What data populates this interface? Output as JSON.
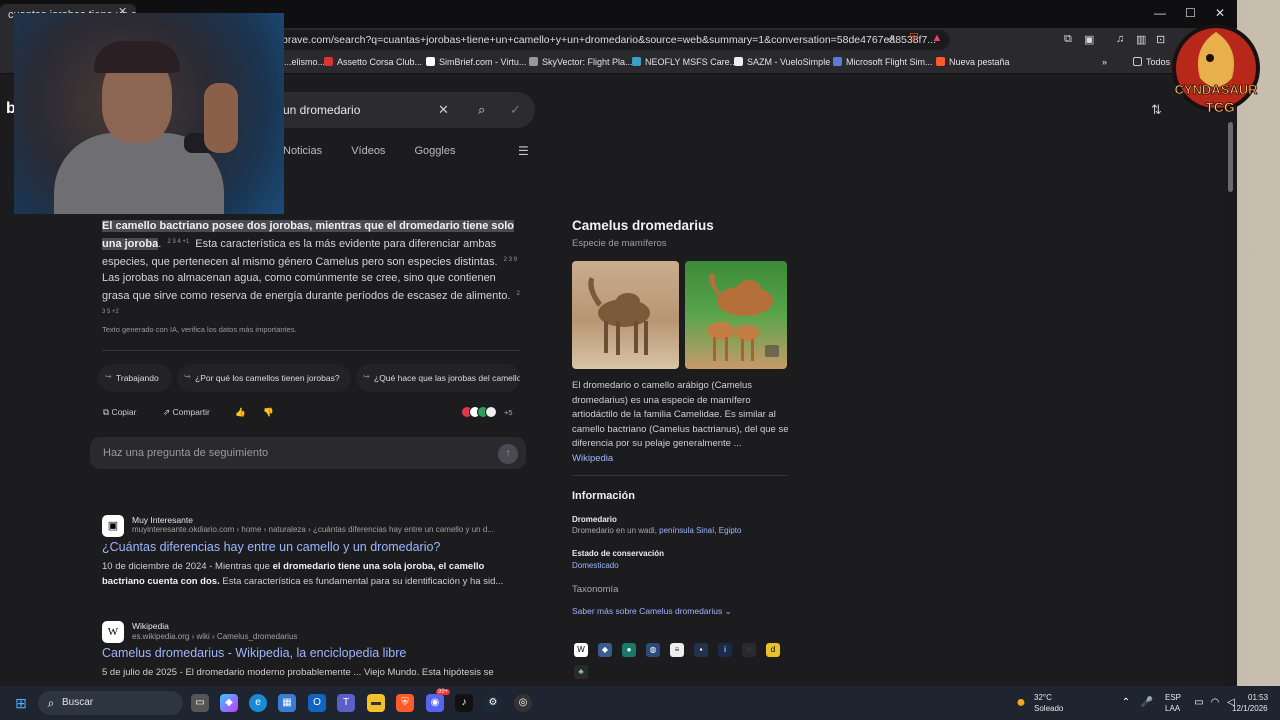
{
  "browser": {
    "tab_title": "cuantas jorobas tiene un camell",
    "url": "brave.com/search?q=cuantas+jorobas+tiene+un+camello+y+un+dromedario&source=web&summary=1&conversation=58de4767ea8538f7...",
    "shield_badge": "2",
    "bookmarks": [
      "...elismo...",
      "Assetto Corsa Club...",
      "SimBrief.com - Virtu...",
      "SkyVector: Flight Pla...",
      "NEOFLY MSFS Care...",
      "SAZM - VueloSimple",
      "Microsoft Flight Sim...",
      "Nueva pestaña",
      "Todos"
    ]
  },
  "search": {
    "query_visible": "un dromedario",
    "tabs": [
      "Noticias",
      "Vídeos",
      "Goggles"
    ]
  },
  "summary": {
    "highlight": "El camello bactriano posee dos jorobas, mientras que el dromedario tiene solo una joroba",
    "after_highlight": ".",
    "cite1": "2 3 4 +1",
    "text1": "Esta característica es la más evidente para diferenciar ambas especies, que pertenecen al mismo género Camelus pero son especies distintas.",
    "cite2": "2 3 9",
    "text2": "Las jorobas no almacenan agua, como comúnmente se cree, sino que contienen grasa que sirve como reserva de energía durante períodos de escasez de alimento.",
    "cite3": "2 3 5 +2",
    "note": "Texto generado con IA, verifica los datos más importantes.",
    "chips": [
      "Trabajando",
      "¿Por qué los camellos tienen jorobas?",
      "¿Qué hace que las jorobas del camello"
    ],
    "copy": "Copiar",
    "share": "Compartir",
    "more_sources": "+5",
    "followup_placeholder": "Haz una pregunta de seguimiento"
  },
  "results": [
    {
      "favicon": "▣",
      "site": "Muy Interesante",
      "url": "muyinteresante.okdiario.com › home › naturaleza › ¿cuántas diferencias hay entre un camello y un d...",
      "title": "¿Cuántas diferencias hay entre un camello y un dromedario?",
      "date": "10 de diciembre de 2024 - ",
      "desc_a": "Mientras que ",
      "desc_b": "el dromedario tiene una sola joroba, el camello bactriano cuenta con dos.",
      "desc_c": " Esta característica es fundamental para su identificación y ha sid..."
    },
    {
      "favicon": "W",
      "site": "Wikipedia",
      "url": "es.wikipedia.org › wiki › Camelus_dromedarius",
      "title": "Camelus dromedarius - Wikipedia, la enciclopedia libre",
      "date": "5 de julio de 2025 - ",
      "desc_a": "El dromedario moderno probablemente ... Viejo Mundo. Esta hipótesis se"
    }
  ],
  "knowledge": {
    "title": "Camelus dromedarius",
    "subtitle": "Especie de mamíferos",
    "description": "El dromedario o camello arábigo (Camelus dromedarius) es una especie de mamífero artiodáctilo de la familia Camelidae. Es similar al camello bactriano (Camelus bactrianus), del que se diferencia por su pelaje generalmente ...",
    "source": "Wikipedia",
    "info_heading": "Información",
    "field1_label": "Dromedario",
    "field1_value": "Dromedario en un wadi, ",
    "field1_link1": "península Sinaí",
    "field1_link2": "Egipto",
    "field2_label": "Estado de conservación",
    "field2_value": "Domesticado",
    "field3_label": "Taxonomía",
    "more": "Saber más sobre Camelus dromedarius"
  },
  "logo": {
    "line1": "CYNDASAUR",
    "line2": "TCG",
    "ring": "EL FUEGO DEL TCG VIVE EN VOS!"
  },
  "taskbar": {
    "search": "Buscar",
    "temp": "32°C",
    "weather": "Soleado",
    "lang1": "ESP",
    "lang2": "LAA",
    "time": "01:53",
    "date": "12/1/2026",
    "discord_badge": "99+"
  },
  "colors": {
    "link": "#9db5ff",
    "page_bg": "#1c1c1f",
    "highlight_bg": "#4a4a52"
  }
}
